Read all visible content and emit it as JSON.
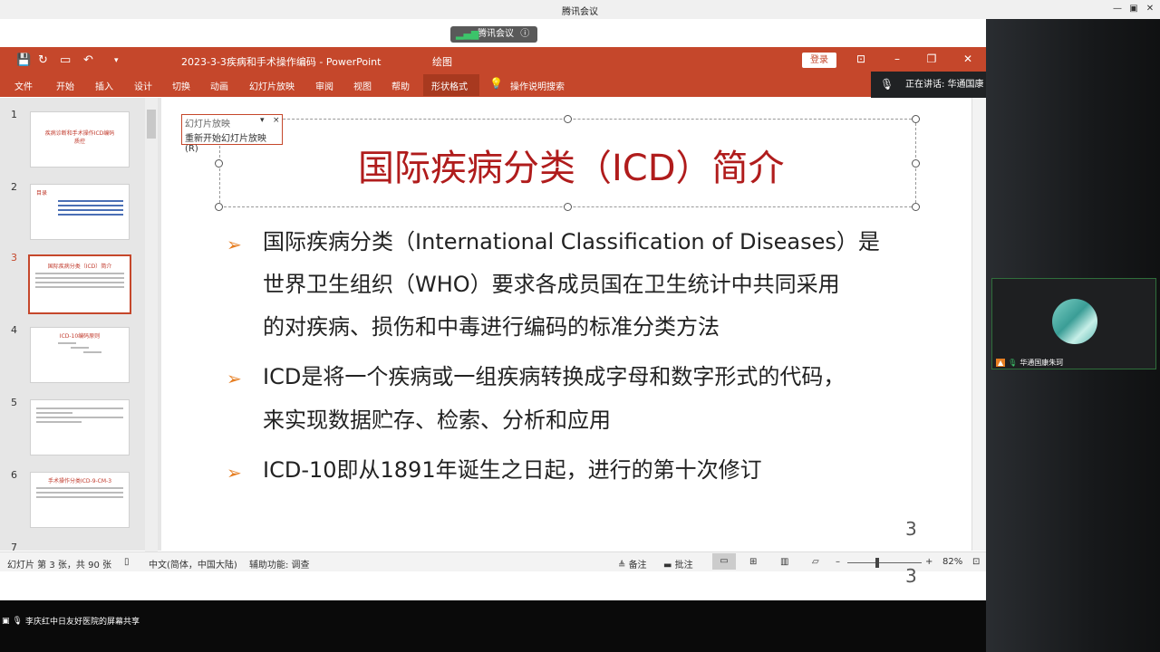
{
  "meeting": {
    "title": "腾讯会议",
    "window_buttons": [
      "—",
      "▣",
      "✕"
    ],
    "toolbar_label": "腾讯会议",
    "speaking_label": "正在讲话: 华通国康",
    "share_label": "李庆红中日友好医院的屏幕共享",
    "participant_name": "华通国康朱珂"
  },
  "ppt": {
    "doc_title": "2023-3-3疾病和手术操作编码  -  PowerPoint",
    "drawing_tools": "绘图",
    "login_label": "登录",
    "ribbon_tabs": [
      "文件",
      "开始",
      "插入",
      "设计",
      "切换",
      "动画",
      "幻灯片放映",
      "审阅",
      "视图",
      "帮助",
      "形状格式"
    ],
    "tell_me": "操作说明搜索",
    "popup": {
      "title": "幻灯片放映",
      "item": "重新开始幻灯片放映(R)"
    },
    "thumbnails": [
      {
        "num": "1",
        "title": "疾病诊断和手术操作ICD编码质控"
      },
      {
        "num": "2",
        "title": "目录"
      },
      {
        "num": "3",
        "title": "国际疾病分类（ICD）简介"
      },
      {
        "num": "4",
        "title": "ICD-10编码原则"
      },
      {
        "num": "5",
        "title": ""
      },
      {
        "num": "6",
        "title": "手术操作分类ICD-9-CM-3"
      },
      {
        "num": "7",
        "title": ""
      }
    ],
    "slide": {
      "title": "国际疾病分类（ICD）简介",
      "bullets": [
        [
          "国际疾病分类（International Classification of Diseases）是",
          "世界卫生组织（WHO）要求各成员国在卫生统计中共同采用",
          "的对疾病、损伤和中毒进行编码的标准分类方法"
        ],
        [
          "ICD是将一个疾病或一组疾病转换成字母和数字形式的代码，",
          "来实现数据贮存、检索、分析和应用"
        ],
        [
          "ICD-10即从1891年诞生之日起，进行的第十次修订"
        ]
      ],
      "page_number": "3"
    },
    "status": {
      "slide_info": "幻灯片 第 3 张，共 90 张",
      "language": "中文(简体，中国大陆)",
      "accessibility": "辅助功能: 调查",
      "notes": "备注",
      "comments": "批注",
      "zoom": "82%"
    }
  },
  "colors": {
    "ppt_red": "#c5472b",
    "title_red": "#b01c1c",
    "bullet_orange": "#e67e22"
  }
}
